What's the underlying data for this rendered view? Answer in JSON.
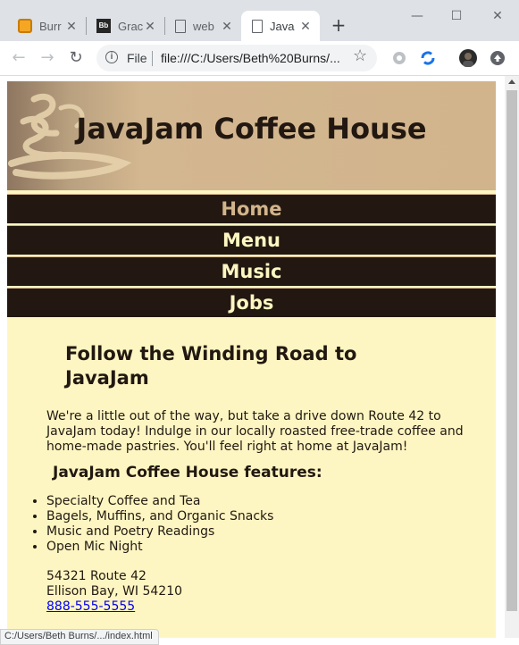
{
  "browser": {
    "tabs": [
      {
        "label": "Burr",
        "icon": "orange-app-icon",
        "active": false
      },
      {
        "label": "Grac",
        "icon": "blackboard-icon",
        "active": false
      },
      {
        "label": "web",
        "icon": "document-icon",
        "active": false
      },
      {
        "label": "Java",
        "icon": "document-icon",
        "active": true
      }
    ],
    "new_tab": "+",
    "window_controls": {
      "minimize": "—",
      "maximize": "☐",
      "close": "✕"
    },
    "scheme_label": "File",
    "url": "file:///C:/Users/Beth%20Burns/...",
    "status_url": "C:/Users/Beth Burns/.../index.html"
  },
  "page": {
    "site_title": "JavaJam Coffee House",
    "nav": [
      {
        "label": "Home",
        "current": true
      },
      {
        "label": "Menu",
        "current": false
      },
      {
        "label": "Music",
        "current": false
      },
      {
        "label": "Jobs",
        "current": false
      }
    ],
    "tagline": "Follow the Winding Road to JavaJam",
    "intro": "We're a little out of the way, but take a drive down Route 42 to JavaJam today! Indulge in our locally roasted free-trade coffee and home-made pastries. You'll feel right at home at JavaJam!",
    "features_heading": "JavaJam Coffee House features:",
    "features": [
      "Specialty Coffee and Tea",
      "Bagels, Muffins, and Organic Snacks",
      "Music and Poetry Readings",
      "Open Mic Night"
    ],
    "address": {
      "street": "54321 Route 42",
      "city": "Ellison Bay, WI 54210",
      "phone": "888-555-5555"
    }
  },
  "colors": {
    "header_bg": "#d2b48c",
    "nav_bg": "#221811",
    "nav_text": "#fef6c2",
    "nav_current": "#d2b48c",
    "content_bg": "#fef6c2",
    "text": "#221811"
  }
}
